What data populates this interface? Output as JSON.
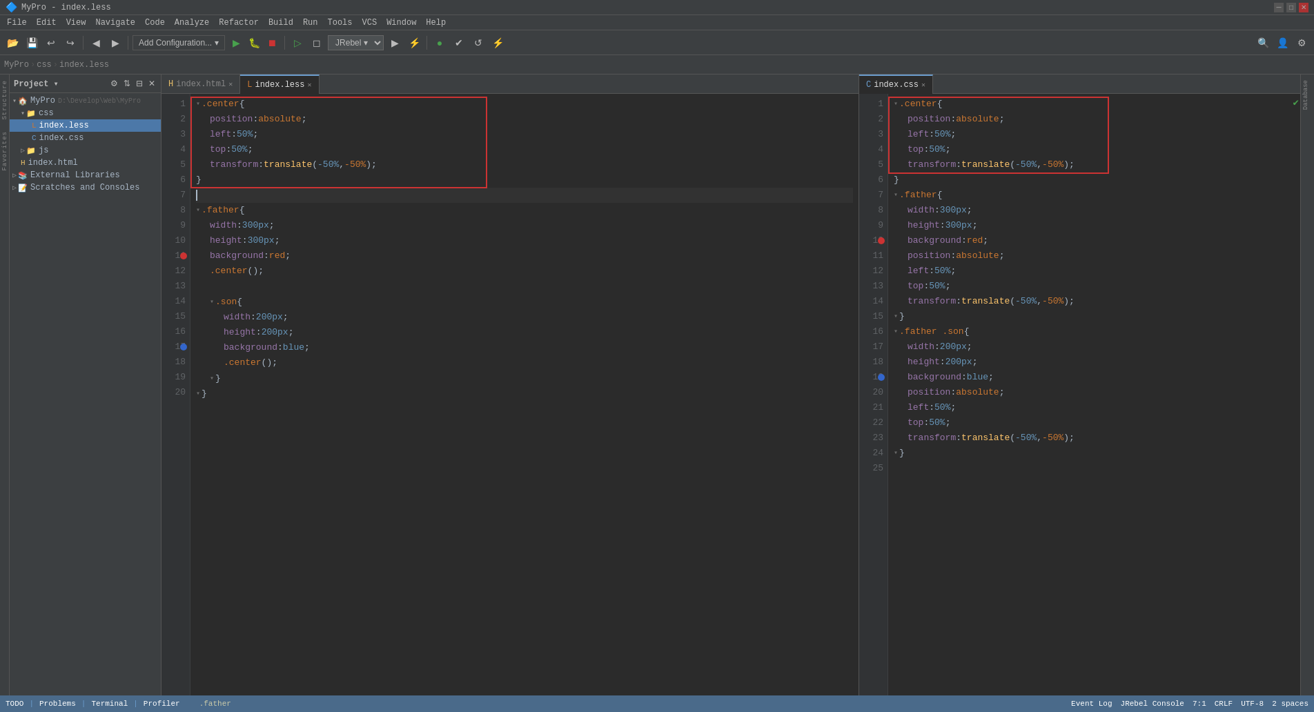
{
  "titlebar": {
    "title": "MyPro - index.less",
    "minimize": "─",
    "maximize": "□",
    "close": "✕"
  },
  "menubar": {
    "items": [
      "File",
      "Edit",
      "View",
      "Navigate",
      "Code",
      "Analyze",
      "Refactor",
      "Build",
      "Run",
      "Tools",
      "VCS",
      "Window",
      "Help"
    ]
  },
  "toolbar": {
    "add_config_label": "Add Configuration...",
    "jrebel_label": "JRebel ▾",
    "buttons": [
      "⟵",
      "⟶",
      "⟳",
      "▶",
      "⏹",
      "⏭",
      "⏸",
      "⚙",
      "⬛",
      "◉",
      "☑",
      "↺",
      "⋯"
    ]
  },
  "toolbar2": {
    "breadcrumb": [
      "MyPro",
      "css",
      "index.less"
    ]
  },
  "project": {
    "label": "Project ▾",
    "tree": [
      {
        "id": "mypro-root",
        "label": "MyPro",
        "path": "D:\\Develop\\Web\\MyPro",
        "level": 0,
        "expanded": true,
        "type": "project"
      },
      {
        "id": "css-folder",
        "label": "css",
        "level": 1,
        "expanded": true,
        "type": "folder"
      },
      {
        "id": "index-less",
        "label": "index.less",
        "level": 2,
        "active": true,
        "type": "less"
      },
      {
        "id": "index-css",
        "label": "index.css",
        "level": 2,
        "type": "css"
      },
      {
        "id": "js-folder",
        "label": "js",
        "level": 1,
        "type": "folder"
      },
      {
        "id": "index-html",
        "label": "index.html",
        "level": 1,
        "type": "html"
      },
      {
        "id": "external-libs",
        "label": "External Libraries",
        "level": 0,
        "type": "folder"
      },
      {
        "id": "scratches",
        "label": "Scratches and Consoles",
        "level": 0,
        "type": "folder"
      }
    ]
  },
  "tabs_left": {
    "tabs": [
      {
        "id": "index-html-tab",
        "label": "index.html",
        "active": false
      },
      {
        "id": "index-less-tab",
        "label": "index.less",
        "active": true
      }
    ]
  },
  "tabs_right": {
    "tabs": [
      {
        "id": "index-css-tab",
        "label": "index.css",
        "active": true
      }
    ]
  },
  "code_left": {
    "lines": [
      {
        "num": 1,
        "content": ".center {",
        "type": "selector"
      },
      {
        "num": 2,
        "content": "    position: absolute;",
        "type": "prop"
      },
      {
        "num": 3,
        "content": "    left: 50%;",
        "type": "prop"
      },
      {
        "num": 4,
        "content": "    top: 50%;",
        "type": "prop"
      },
      {
        "num": 5,
        "content": "    transform: translate(-50%, -50%);",
        "type": "prop"
      },
      {
        "num": 6,
        "content": "}",
        "type": "brace"
      },
      {
        "num": 7,
        "content": "",
        "type": "empty",
        "cursor": true
      },
      {
        "num": 8,
        "content": ".father {",
        "type": "selector"
      },
      {
        "num": 9,
        "content": "    width: 300px;",
        "type": "prop"
      },
      {
        "num": 10,
        "content": "    height: 300px;",
        "type": "prop"
      },
      {
        "num": 11,
        "content": "    background: red;",
        "type": "prop",
        "marker": "red"
      },
      {
        "num": 12,
        "content": "    .center();",
        "type": "mixin"
      },
      {
        "num": 13,
        "content": "",
        "type": "empty"
      },
      {
        "num": 14,
        "content": "    .son {",
        "type": "selector"
      },
      {
        "num": 15,
        "content": "        width: 200px;",
        "type": "prop"
      },
      {
        "num": 16,
        "content": "        height: 200px;",
        "type": "prop"
      },
      {
        "num": 17,
        "content": "        background: blue;",
        "type": "prop",
        "marker": "blue"
      },
      {
        "num": 18,
        "content": "        .center();",
        "type": "mixin"
      },
      {
        "num": 19,
        "content": "    }",
        "type": "brace"
      },
      {
        "num": 20,
        "content": "}",
        "type": "brace"
      }
    ]
  },
  "code_right": {
    "lines": [
      {
        "num": 1,
        "content": ".center {"
      },
      {
        "num": 2,
        "content": "    position: absolute;"
      },
      {
        "num": 3,
        "content": "    left: 50%;"
      },
      {
        "num": 4,
        "content": "    top: 50%;"
      },
      {
        "num": 5,
        "content": "    transform: translate(-50%, -50%);"
      },
      {
        "num": 6,
        "content": "}"
      },
      {
        "num": 7,
        "content": ".father {"
      },
      {
        "num": 8,
        "content": "    width: 300px;"
      },
      {
        "num": 9,
        "content": "    height: 300px;"
      },
      {
        "num": 10,
        "content": "    background: red;",
        "marker": "red"
      },
      {
        "num": 11,
        "content": "    position: absolute;"
      },
      {
        "num": 12,
        "content": "    left: 50%;"
      },
      {
        "num": 13,
        "content": "    top: 50%;"
      },
      {
        "num": 14,
        "content": "    transform: translate(-50%, -50%);"
      },
      {
        "num": 15,
        "content": "}"
      },
      {
        "num": 16,
        "content": ".father .son {"
      },
      {
        "num": 17,
        "content": "    width: 200px;"
      },
      {
        "num": 18,
        "content": "    height: 200px;"
      },
      {
        "num": 19,
        "content": "    background: blue;",
        "marker": "blue"
      },
      {
        "num": 20,
        "content": "    position: absolute;"
      },
      {
        "num": 21,
        "content": "    left: 50%;"
      },
      {
        "num": 22,
        "content": "    top: 50%;"
      },
      {
        "num": 23,
        "content": "    transform: translate(-50%, -50%);"
      },
      {
        "num": 24,
        "content": "}"
      },
      {
        "num": 25,
        "content": ""
      }
    ]
  },
  "statusbar": {
    "todo": "TODO",
    "problems": "Problems",
    "terminal": "Terminal",
    "profiler": "Profiler",
    "cursor_pos": "7:1",
    "line_ending": "CRLF",
    "encoding": "UTF-8",
    "indent": "2 spaces",
    "event_log": "Event Log",
    "jrebel_console": "JRebel Console",
    "bottom_label": ".father"
  },
  "structure_tabs": {
    "items": [
      "Structure",
      "Favorites"
    ]
  },
  "right_side_items": [
    "Database"
  ]
}
